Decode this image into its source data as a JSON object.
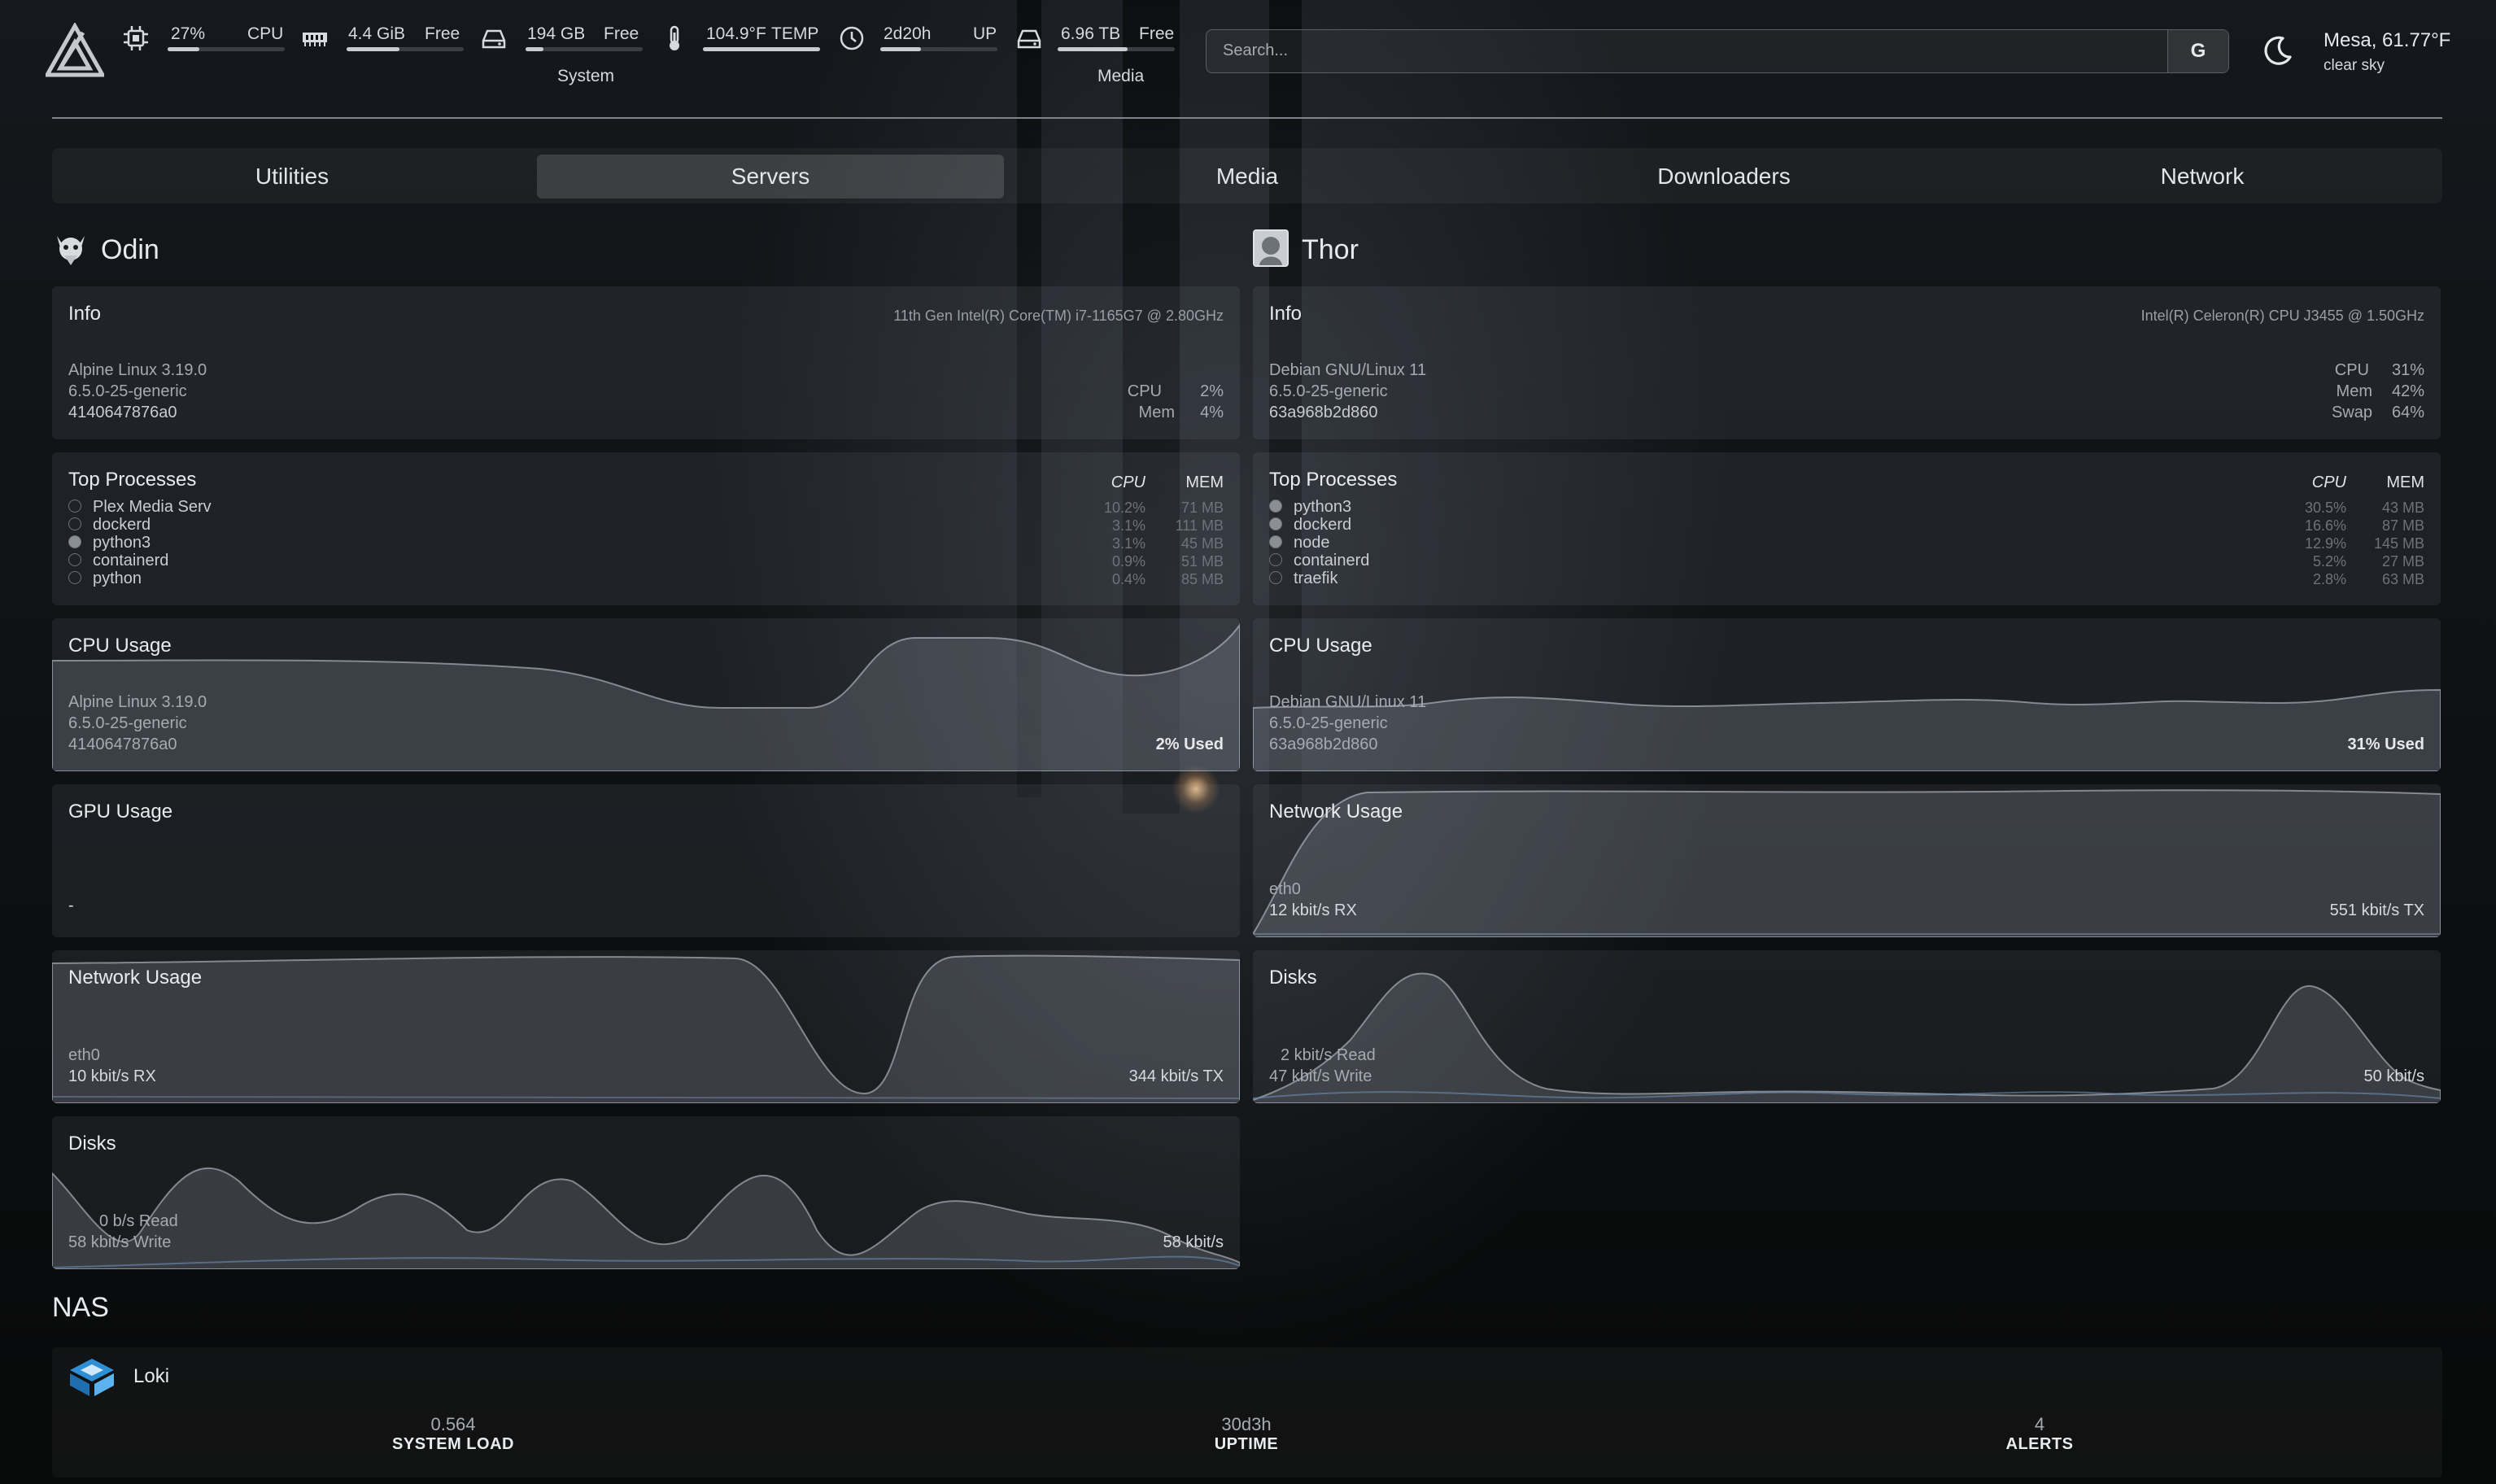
{
  "header": {
    "resources": [
      {
        "icon": "cpu-icon",
        "value": "27%",
        "label": "CPU",
        "fill": 0.27
      },
      {
        "icon": "memory-icon",
        "value": "4.4 GiB",
        "label": "Free",
        "fill": 0.45
      },
      {
        "icon": "disk-icon",
        "value": "194 GB",
        "label": "Free",
        "fill": 0.15
      },
      {
        "icon": "thermometer-icon",
        "value": "104.9°F",
        "label": "TEMP",
        "fill": 1.0
      },
      {
        "icon": "clock-icon",
        "value": "2d20h",
        "label": "UP",
        "fill": 0.35
      },
      {
        "icon": "disk-icon",
        "value": "6.96 TB",
        "label": "Free",
        "fill": 0.6
      }
    ],
    "group_system": "System",
    "group_media": "Media",
    "search_placeholder": "Search...",
    "search_provider": "G",
    "weather_location": "Mesa, 61.77°F",
    "weather_condition": "clear sky"
  },
  "tabs": [
    "Utilities",
    "Servers",
    "Media",
    "Downloaders",
    "Network"
  ],
  "active_tab": "Servers",
  "odin": {
    "name": "Odin",
    "info_title": "Info",
    "cpu_model": "11th Gen Intel(R) Core(TM) i7-1165G7 @ 2.80GHz",
    "os": "Alpine Linux 3.19.0",
    "kernel": "6.5.0-25-generic",
    "host": "4140647876a0",
    "cpu_label": "CPU",
    "cpu_val": "2%",
    "mem_label": "Mem",
    "mem_val": "4%",
    "top_title": "Top Processes",
    "col_cpu": "CPU",
    "col_mem": "MEM",
    "processes": [
      {
        "name": "Plex Media Serv",
        "cpu": "10.2%",
        "mem": "71 MB",
        "filled": false
      },
      {
        "name": "dockerd",
        "cpu": "3.1%",
        "mem": "111 MB",
        "filled": false
      },
      {
        "name": "python3",
        "cpu": "3.1%",
        "mem": "45 MB",
        "filled": true
      },
      {
        "name": "containerd",
        "cpu": "0.9%",
        "mem": "51 MB",
        "filled": false
      },
      {
        "name": "python",
        "cpu": "0.4%",
        "mem": "85 MB",
        "filled": false
      }
    ],
    "cpu_usage_title": "CPU Usage",
    "cpu_used": "2% Used",
    "gpu_title": "GPU Usage",
    "gpu_val": "-",
    "net_title": "Network Usage",
    "iface": "eth0",
    "rx": "10 kbit/s RX",
    "tx": "344 kbit/s TX",
    "disks_title": "Disks",
    "read": "0 b/s Read",
    "write": "58 kbit/s Write",
    "disk_total": "58 kbit/s"
  },
  "thor": {
    "name": "Thor",
    "info_title": "Info",
    "cpu_model": "Intel(R) Celeron(R) CPU J3455 @ 1.50GHz",
    "os": "Debian GNU/Linux 11",
    "kernel": "6.5.0-25-generic",
    "host": "63a968b2d860",
    "cpu_label": "CPU",
    "cpu_val": "31%",
    "mem_label": "Mem",
    "mem_val": "42%",
    "swap_label": "Swap",
    "swap_val": "64%",
    "top_title": "Top Processes",
    "col_cpu": "CPU",
    "col_mem": "MEM",
    "processes": [
      {
        "name": "python3",
        "cpu": "30.5%",
        "mem": "43 MB",
        "filled": true
      },
      {
        "name": "dockerd",
        "cpu": "16.6%",
        "mem": "87 MB",
        "filled": true
      },
      {
        "name": "node",
        "cpu": "12.9%",
        "mem": "145 MB",
        "filled": true
      },
      {
        "name": "containerd",
        "cpu": "5.2%",
        "mem": "27 MB",
        "filled": false
      },
      {
        "name": "traefik",
        "cpu": "2.8%",
        "mem": "63 MB",
        "filled": false
      }
    ],
    "cpu_usage_title": "CPU Usage",
    "cpu_used": "31% Used",
    "net_title": "Network Usage",
    "iface": "eth0",
    "rx": "12 kbit/s RX",
    "tx": "551 kbit/s TX",
    "disks_title": "Disks",
    "read": "2 kbit/s Read",
    "write": "47 kbit/s Write",
    "disk_total": "50 kbit/s"
  },
  "nas": {
    "section_title": "NAS",
    "name": "Loki",
    "load": "0.564",
    "load_label": "SYSTEM LOAD",
    "uptime": "30d3h",
    "uptime_label": "UPTIME",
    "alerts": "4",
    "alerts_label": "ALERTS"
  }
}
